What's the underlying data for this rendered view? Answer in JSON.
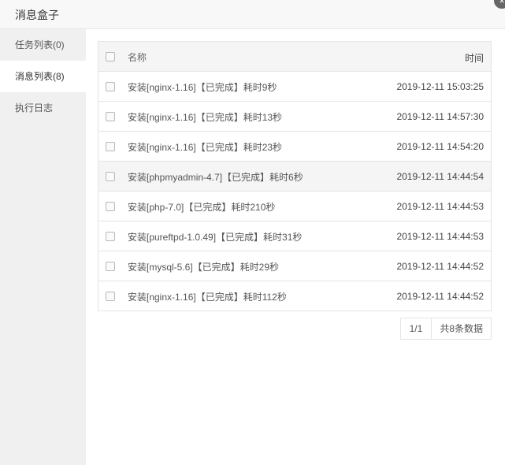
{
  "dialog": {
    "title": "消息盒子",
    "close_label": "×"
  },
  "sidebar": {
    "items": [
      {
        "label": "任务列表(0)"
      },
      {
        "label": "消息列表(8)"
      },
      {
        "label": "执行日志"
      }
    ]
  },
  "table": {
    "columns": {
      "name": "名称",
      "time": "时间"
    },
    "rows": [
      {
        "name": "安装[nginx-1.16]【已完成】耗时9秒",
        "time": "2019-12-11 15:03:25"
      },
      {
        "name": "安装[nginx-1.16]【已完成】耗时13秒",
        "time": "2019-12-11 14:57:30"
      },
      {
        "name": "安装[nginx-1.16]【已完成】耗时23秒",
        "time": "2019-12-11 14:54:20"
      },
      {
        "name": "安装[phpmyadmin-4.7]【已完成】耗时6秒",
        "time": "2019-12-11 14:44:54"
      },
      {
        "name": "安装[php-7.0]【已完成】耗时210秒",
        "time": "2019-12-11 14:44:53"
      },
      {
        "name": "安装[pureftpd-1.0.49]【已完成】耗时31秒",
        "time": "2019-12-11 14:44:53"
      },
      {
        "name": "安装[mysql-5.6]【已完成】耗时29秒",
        "time": "2019-12-11 14:44:52"
      },
      {
        "name": "安装[nginx-1.16]【已完成】耗时112秒",
        "time": "2019-12-11 14:44:52"
      }
    ]
  },
  "pager": {
    "page": "1/1",
    "total": "共8条数据"
  }
}
